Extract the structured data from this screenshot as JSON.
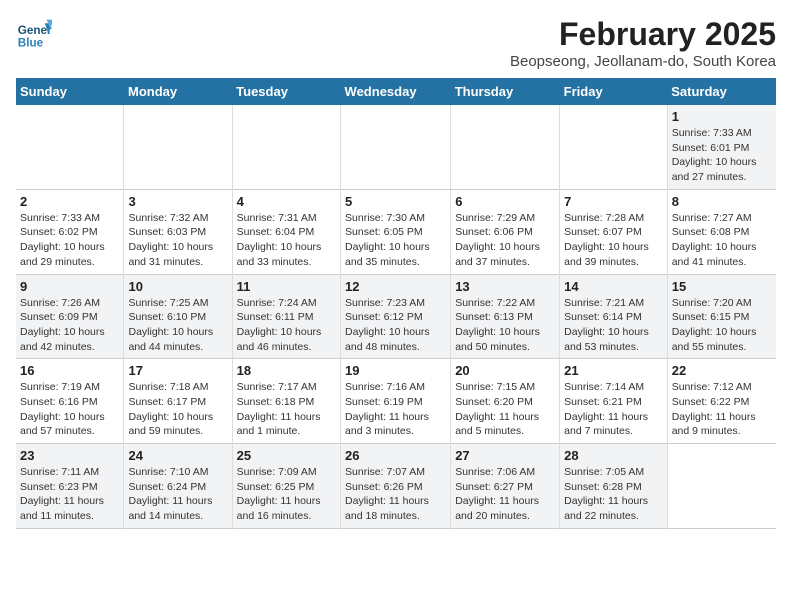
{
  "logo": {
    "general": "General",
    "blue": "Blue"
  },
  "header": {
    "month": "February 2025",
    "location": "Beopseong, Jeollanam-do, South Korea"
  },
  "days_of_week": [
    "Sunday",
    "Monday",
    "Tuesday",
    "Wednesday",
    "Thursday",
    "Friday",
    "Saturday"
  ],
  "weeks": [
    [
      {
        "day": "",
        "info": ""
      },
      {
        "day": "",
        "info": ""
      },
      {
        "day": "",
        "info": ""
      },
      {
        "day": "",
        "info": ""
      },
      {
        "day": "",
        "info": ""
      },
      {
        "day": "",
        "info": ""
      },
      {
        "day": "1",
        "info": "Sunrise: 7:33 AM\nSunset: 6:01 PM\nDaylight: 10 hours and 27 minutes."
      }
    ],
    [
      {
        "day": "2",
        "info": "Sunrise: 7:33 AM\nSunset: 6:02 PM\nDaylight: 10 hours and 29 minutes."
      },
      {
        "day": "3",
        "info": "Sunrise: 7:32 AM\nSunset: 6:03 PM\nDaylight: 10 hours and 31 minutes."
      },
      {
        "day": "4",
        "info": "Sunrise: 7:31 AM\nSunset: 6:04 PM\nDaylight: 10 hours and 33 minutes."
      },
      {
        "day": "5",
        "info": "Sunrise: 7:30 AM\nSunset: 6:05 PM\nDaylight: 10 hours and 35 minutes."
      },
      {
        "day": "6",
        "info": "Sunrise: 7:29 AM\nSunset: 6:06 PM\nDaylight: 10 hours and 37 minutes."
      },
      {
        "day": "7",
        "info": "Sunrise: 7:28 AM\nSunset: 6:07 PM\nDaylight: 10 hours and 39 minutes."
      },
      {
        "day": "8",
        "info": "Sunrise: 7:27 AM\nSunset: 6:08 PM\nDaylight: 10 hours and 41 minutes."
      }
    ],
    [
      {
        "day": "9",
        "info": "Sunrise: 7:26 AM\nSunset: 6:09 PM\nDaylight: 10 hours and 42 minutes."
      },
      {
        "day": "10",
        "info": "Sunrise: 7:25 AM\nSunset: 6:10 PM\nDaylight: 10 hours and 44 minutes."
      },
      {
        "day": "11",
        "info": "Sunrise: 7:24 AM\nSunset: 6:11 PM\nDaylight: 10 hours and 46 minutes."
      },
      {
        "day": "12",
        "info": "Sunrise: 7:23 AM\nSunset: 6:12 PM\nDaylight: 10 hours and 48 minutes."
      },
      {
        "day": "13",
        "info": "Sunrise: 7:22 AM\nSunset: 6:13 PM\nDaylight: 10 hours and 50 minutes."
      },
      {
        "day": "14",
        "info": "Sunrise: 7:21 AM\nSunset: 6:14 PM\nDaylight: 10 hours and 53 minutes."
      },
      {
        "day": "15",
        "info": "Sunrise: 7:20 AM\nSunset: 6:15 PM\nDaylight: 10 hours and 55 minutes."
      }
    ],
    [
      {
        "day": "16",
        "info": "Sunrise: 7:19 AM\nSunset: 6:16 PM\nDaylight: 10 hours and 57 minutes."
      },
      {
        "day": "17",
        "info": "Sunrise: 7:18 AM\nSunset: 6:17 PM\nDaylight: 10 hours and 59 minutes."
      },
      {
        "day": "18",
        "info": "Sunrise: 7:17 AM\nSunset: 6:18 PM\nDaylight: 11 hours and 1 minute."
      },
      {
        "day": "19",
        "info": "Sunrise: 7:16 AM\nSunset: 6:19 PM\nDaylight: 11 hours and 3 minutes."
      },
      {
        "day": "20",
        "info": "Sunrise: 7:15 AM\nSunset: 6:20 PM\nDaylight: 11 hours and 5 minutes."
      },
      {
        "day": "21",
        "info": "Sunrise: 7:14 AM\nSunset: 6:21 PM\nDaylight: 11 hours and 7 minutes."
      },
      {
        "day": "22",
        "info": "Sunrise: 7:12 AM\nSunset: 6:22 PM\nDaylight: 11 hours and 9 minutes."
      }
    ],
    [
      {
        "day": "23",
        "info": "Sunrise: 7:11 AM\nSunset: 6:23 PM\nDaylight: 11 hours and 11 minutes."
      },
      {
        "day": "24",
        "info": "Sunrise: 7:10 AM\nSunset: 6:24 PM\nDaylight: 11 hours and 14 minutes."
      },
      {
        "day": "25",
        "info": "Sunrise: 7:09 AM\nSunset: 6:25 PM\nDaylight: 11 hours and 16 minutes."
      },
      {
        "day": "26",
        "info": "Sunrise: 7:07 AM\nSunset: 6:26 PM\nDaylight: 11 hours and 18 minutes."
      },
      {
        "day": "27",
        "info": "Sunrise: 7:06 AM\nSunset: 6:27 PM\nDaylight: 11 hours and 20 minutes."
      },
      {
        "day": "28",
        "info": "Sunrise: 7:05 AM\nSunset: 6:28 PM\nDaylight: 11 hours and 22 minutes."
      },
      {
        "day": "",
        "info": ""
      }
    ]
  ]
}
